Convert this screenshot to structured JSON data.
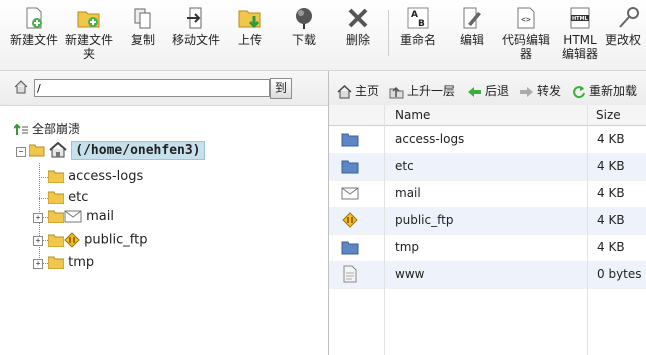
{
  "toolbar": {
    "new_file": "新建文件",
    "new_folder": "新建文件夹",
    "new_folder_l1": "新建文件",
    "new_folder_l2": "夹",
    "copy": "复制",
    "move": "移动文件",
    "upload": "上传",
    "download": "下载",
    "delete": "删除",
    "rename": "重命名",
    "edit": "编辑",
    "code_editor_l1": "代码编辑",
    "code_editor_l2": "器",
    "html_editor_l1": "HTML",
    "html_editor_l2": "编辑器",
    "change_perms": "更改权"
  },
  "left": {
    "path_value": "/",
    "go_label": "到",
    "collapse_all": "全部崩溃",
    "root": "(/home/onehfen3)",
    "tree": [
      {
        "label": "access-logs",
        "icon": "folder-icon"
      },
      {
        "label": "etc",
        "icon": "folder-icon"
      },
      {
        "label": "mail",
        "icon": "mail-folder-icon"
      },
      {
        "label": "public_ftp",
        "icon": "ftp-folder-icon"
      },
      {
        "label": "tmp",
        "icon": "folder-icon"
      }
    ]
  },
  "right": {
    "nav": {
      "home": "主页",
      "up": "上升一层",
      "back": "后退",
      "forward": "转发",
      "reload": "重新加载"
    },
    "columns": {
      "name": "Name",
      "size": "Size"
    },
    "files": [
      {
        "name": "access-logs",
        "size": "4 KB",
        "icon": "folder-icon"
      },
      {
        "name": "etc",
        "size": "4 KB",
        "icon": "folder-icon"
      },
      {
        "name": "mail",
        "size": "4 KB",
        "icon": "mail-icon"
      },
      {
        "name": "public_ftp",
        "size": "4 KB",
        "icon": "ftp-icon"
      },
      {
        "name": "tmp",
        "size": "4 KB",
        "icon": "folder-icon"
      },
      {
        "name": "www",
        "size": "0 bytes",
        "icon": "file-icon"
      }
    ]
  },
  "colors": {
    "folder_blue": "#5d87c4",
    "folder_yellow": "#f1c74b",
    "root_highlight": "#c6e0ec",
    "row_alt": "#eef3fb"
  }
}
